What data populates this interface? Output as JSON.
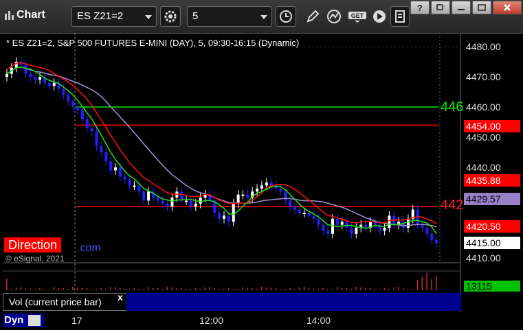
{
  "toolbar": {
    "app_title": "Chart",
    "symbol": "ES Z21=2",
    "interval": "5",
    "icons": [
      "gear-icon",
      "clock-icon",
      "pencil-icon",
      "chart-study-icon",
      "get-icon",
      "play-icon",
      "page-icon"
    ],
    "window_buttons": [
      "help",
      "restore-down",
      "minimize",
      "maximize",
      "close"
    ]
  },
  "chart": {
    "header": "* ES Z21=2, S&P 500 FUTURES E-MINI (DAY), 5, 09:30-16:15 (Dynamic)",
    "copyright": "© eSignal, 2021",
    "direction_label": "Direction",
    "direction_link_text": ".com",
    "y_ticks": [
      "4480.00",
      "4470.00",
      "4460.00",
      "4450.00",
      "4440.00",
      "4410.00"
    ],
    "price_tags": [
      {
        "text": "4454.00",
        "bg": "#ff0000",
        "fg": "#ffffff"
      },
      {
        "text": "4435.88",
        "bg": "#ff0000",
        "fg": "#ffffff"
      },
      {
        "text": "4429.57",
        "bg": "#9980c8",
        "fg": "#000000"
      },
      {
        "text": "4420.50",
        "bg": "#ff0000",
        "fg": "#ffffff"
      },
      {
        "text": "4415.00",
        "bg": "#ffffff",
        "fg": "#000000"
      }
    ],
    "line_labels": [
      {
        "text": "446",
        "color": "#00ee00"
      },
      {
        "text": "442",
        "color": "#ff2020"
      }
    ],
    "x_labels": [
      "17",
      "12:00",
      "14:00"
    ],
    "volume_pane": {
      "label": "Vol (current price bar)",
      "close_label": "x",
      "value": "13115"
    },
    "dyn_label": "Dyn"
  },
  "colors": {
    "up_candle": "#ffffff",
    "down_candle": "#2020ff",
    "ma_red": "#ff1010",
    "ma_green": "#20e020",
    "ma_purple": "#a890d8",
    "level_green": "#00ee00",
    "level_red": "#ff0000"
  },
  "chart_data": {
    "type": "candlestick",
    "title": "* ES Z21=2, S&P 500 FUTURES E-MINI (DAY), 5, 09:30-16:15 (Dynamic)",
    "ylim": [
      4407,
      4483
    ],
    "y_ticks": [
      4480,
      4470,
      4460,
      4450,
      4440,
      4410
    ],
    "horizontal_levels": [
      {
        "value": 4460.0,
        "color": "#00ee00"
      },
      {
        "value": 4454.0,
        "color": "#ff0000"
      },
      {
        "value": 4427.0,
        "color": "#ff0000"
      }
    ],
    "close_series": [
      4471,
      4473,
      4475,
      4474,
      4471,
      4470,
      4469,
      4470,
      4468,
      4467,
      4468,
      4466,
      4464,
      4462,
      4460,
      4459,
      4456,
      4453,
      4452,
      4447,
      4445,
      4442,
      4439,
      4440,
      4437,
      4436,
      4434,
      4434,
      4432,
      4429,
      4432,
      4430,
      4429,
      4428,
      4427,
      4430,
      4432,
      4429,
      4429,
      4427,
      4428,
      4430,
      4431,
      4429,
      4425,
      4423,
      4424,
      4422,
      4428,
      4431,
      4431,
      4430,
      4432,
      4433,
      4434,
      4435,
      4434,
      4433,
      4432,
      4429,
      4427,
      4426,
      4425,
      4425,
      4424,
      4423,
      4421,
      4419,
      4418,
      4423,
      4421,
      4422,
      4420,
      4418,
      4420,
      4421,
      4420,
      4422,
      4421,
      4419,
      4420,
      4424,
      4421,
      4422,
      4420,
      4423,
      4426,
      4421,
      4420,
      4418,
      4416,
      4415
    ],
    "volume_latest": 13115,
    "series": [
      {
        "name": "MA red",
        "color": "#ff1010"
      },
      {
        "name": "MA green",
        "color": "#20e020"
      },
      {
        "name": "MA purple",
        "color": "#a890d8"
      }
    ],
    "x_labels": [
      "17",
      "12:00",
      "14:00"
    ]
  }
}
